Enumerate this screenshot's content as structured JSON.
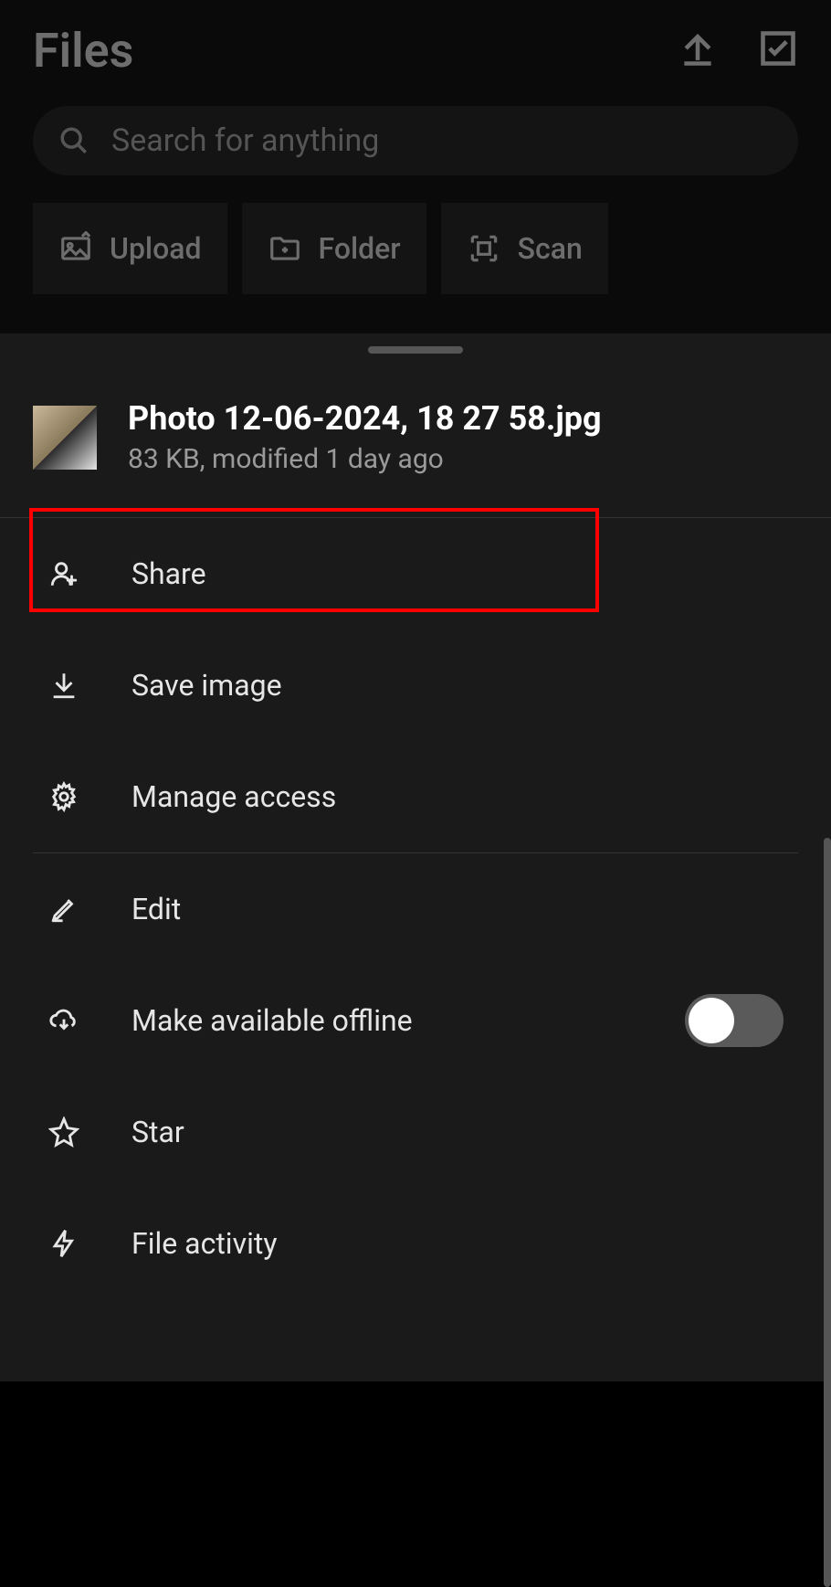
{
  "header": {
    "title": "Files"
  },
  "search": {
    "placeholder": "Search for anything"
  },
  "actions": {
    "upload": "Upload",
    "folder": "Folder",
    "scan": "Scan"
  },
  "file": {
    "name": "Photo 12-06-2024, 18 27 58.jpg",
    "subtitle": "83 KB, modified 1 day ago"
  },
  "menu": {
    "share": "Share",
    "save_image": "Save image",
    "manage_access": "Manage access",
    "edit": "Edit",
    "offline": "Make available offline",
    "star": "Star",
    "file_activity": "File activity"
  },
  "offline_toggle": false
}
